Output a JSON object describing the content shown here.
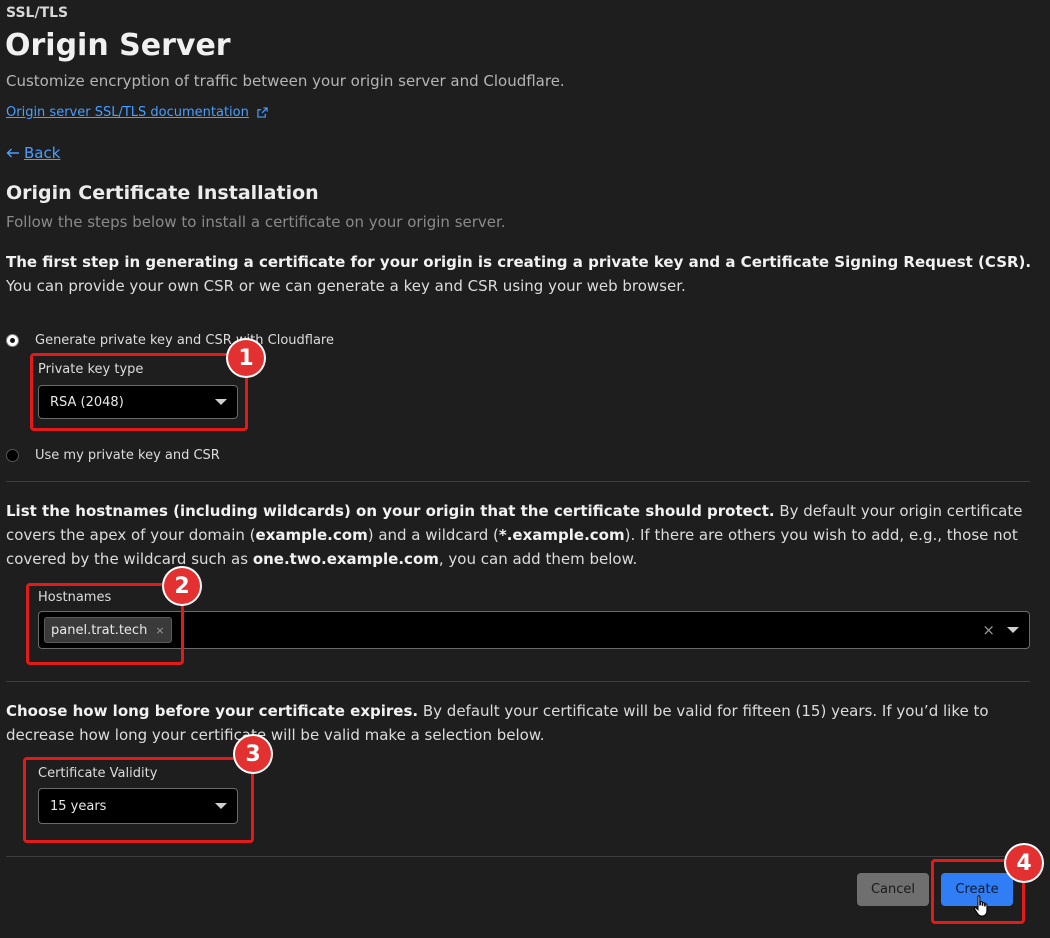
{
  "header": {
    "section": "SSL/TLS",
    "title": "Origin Server",
    "subtitle": "Customize encryption of traffic between your origin server and Cloudflare.",
    "doc_link": "Origin server SSL/TLS documentation",
    "back": "Back"
  },
  "install": {
    "title": "Origin Certificate Installation",
    "subtitle": "Follow the steps below to install a certificate on your origin server."
  },
  "step1": {
    "bold": "The first step in generating a certificate for your origin is creating a private key and a Certificate Signing Request (CSR).",
    "rest": " You can provide your own CSR or we can generate a key and CSR using your web browser.",
    "radio_generate": "Generate private key and CSR with Cloudflare",
    "key_type_label": "Private key type",
    "key_type_value": "RSA (2048)",
    "radio_own": "Use my private key and CSR"
  },
  "step2": {
    "bold": "List the hostnames (including wildcards) on your origin that the certificate should protect.",
    "t1": " By default your origin certificate covers the apex of your domain (",
    "apex": "example.com",
    "t2": ") and a wildcard (",
    "wildcard": "*.example.com",
    "t3": "). If there are others you wish to add, e.g., those not covered by the wildcard such as ",
    "example_sub": "one.two.example.com",
    "t4": ", you can add them below.",
    "hostnames_label": "Hostnames",
    "hostname_chip": "panel.trat.tech",
    "chip_remove": "×",
    "clear": "×"
  },
  "step3": {
    "bold": "Choose how long before your certificate expires.",
    "rest": " By default your certificate will be valid for fifteen (15) years. If you’d like to decrease how long your certificate will be valid make a selection below.",
    "validity_label": "Certificate Validity",
    "validity_value": "15 years"
  },
  "actions": {
    "cancel": "Cancel",
    "create": "Create"
  },
  "annotations": [
    "1",
    "2",
    "3",
    "4"
  ],
  "colors": {
    "background": "#1e1e1e",
    "link": "#4a9eff",
    "highlight": "#e21a1a",
    "primary_button": "#2f7ef5"
  }
}
